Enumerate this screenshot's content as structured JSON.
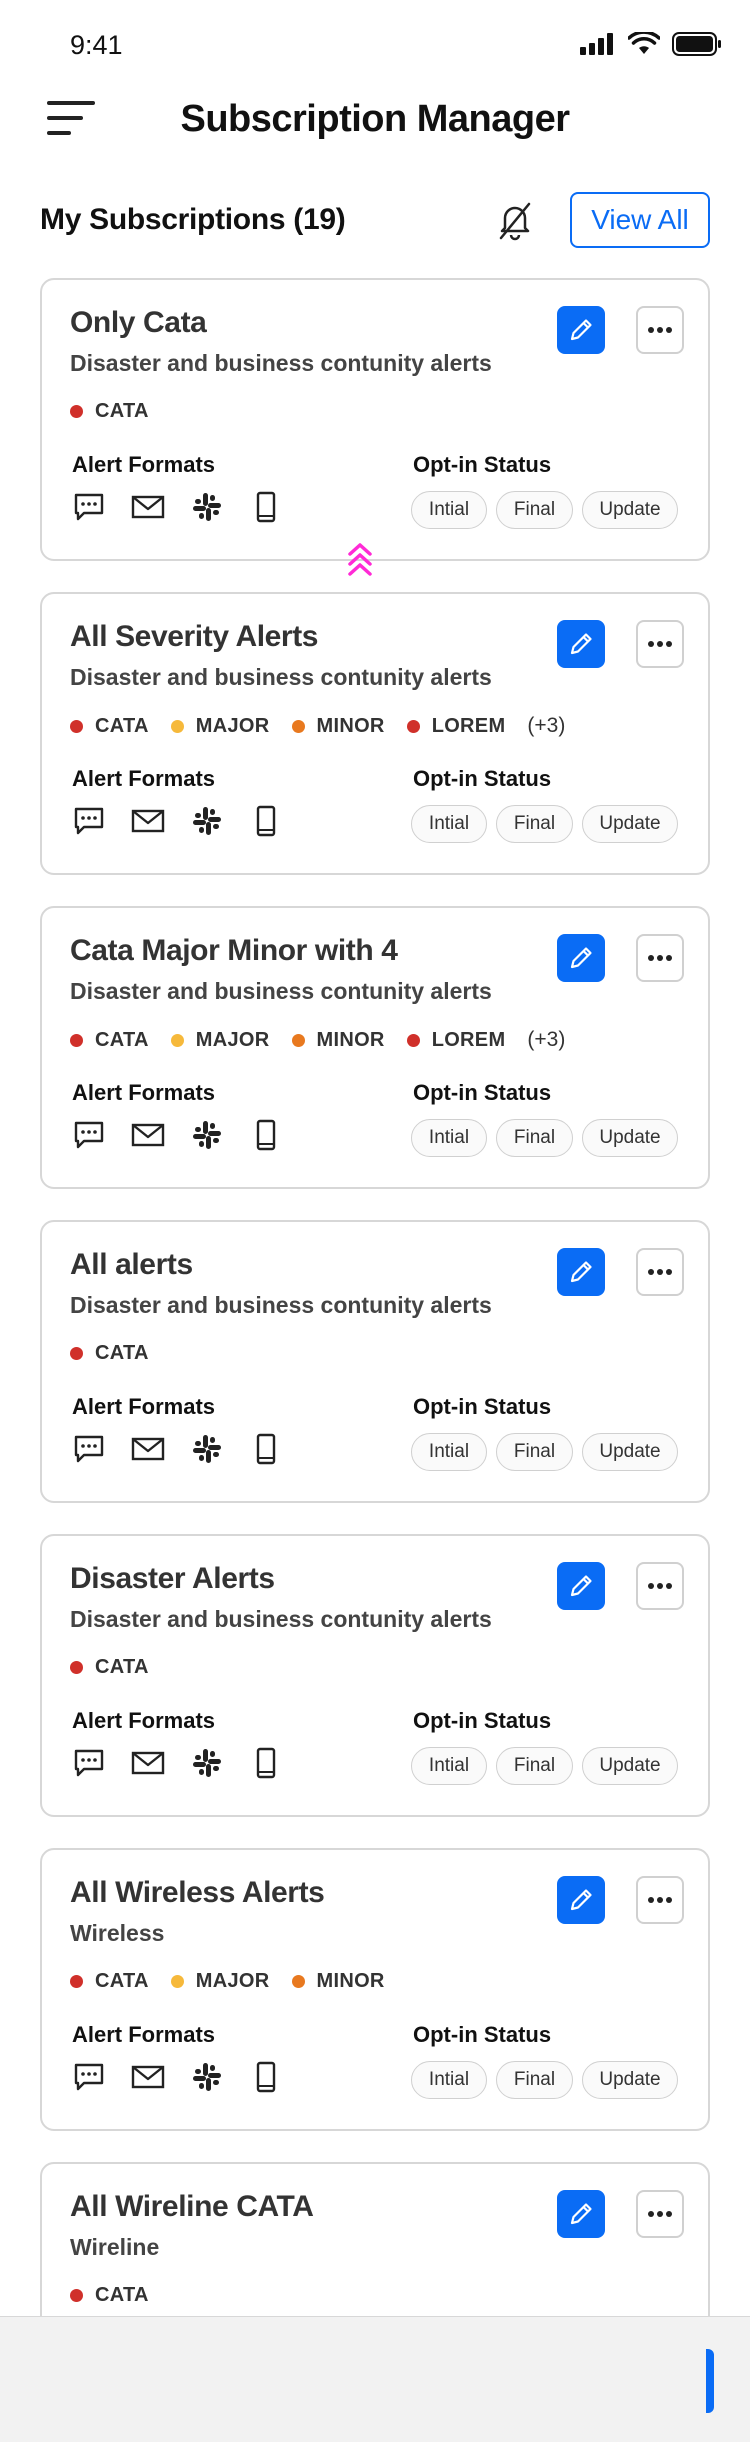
{
  "status_bar": {
    "time": "9:41"
  },
  "header": {
    "title": "Subscription Manager"
  },
  "subscriptions": {
    "heading": "My Subscriptions (19)",
    "view_all_label": "View All"
  },
  "colors": {
    "accent": "#0a6cf5",
    "cata": "#d0302a",
    "major": "#f6b93b",
    "minor": "#e8791f",
    "lorem": "#d0302a"
  },
  "card_labels": {
    "alert_formats": "Alert Formats",
    "optin_status": "Opt-in Status",
    "pills": [
      "Intial",
      "Final",
      "Update"
    ]
  },
  "cards": [
    {
      "title": "Only Cata",
      "subtitle": "Disaster and business contunity alerts",
      "tags": [
        {
          "label": "CATA",
          "color": "#d0302a"
        }
      ],
      "more": ""
    },
    {
      "title": "All Severity Alerts",
      "subtitle": "Disaster and business contunity alerts",
      "tags": [
        {
          "label": "CATA",
          "color": "#d0302a"
        },
        {
          "label": "MAJOR",
          "color": "#f6b93b"
        },
        {
          "label": "MINOR",
          "color": "#e8791f"
        },
        {
          "label": "LOREM",
          "color": "#d0302a"
        }
      ],
      "more": "(+3)"
    },
    {
      "title": "Cata Major Minor with 4",
      "subtitle": "Disaster and business contunity alerts",
      "tags": [
        {
          "label": "CATA",
          "color": "#d0302a"
        },
        {
          "label": "MAJOR",
          "color": "#f6b93b"
        },
        {
          "label": "MINOR",
          "color": "#e8791f"
        },
        {
          "label": "LOREM",
          "color": "#d0302a"
        }
      ],
      "more": "(+3)"
    },
    {
      "title": "All alerts",
      "subtitle": "Disaster and business contunity alerts",
      "tags": [
        {
          "label": "CATA",
          "color": "#d0302a"
        }
      ],
      "more": ""
    },
    {
      "title": "Disaster Alerts",
      "subtitle": "Disaster and business contunity alerts",
      "tags": [
        {
          "label": "CATA",
          "color": "#d0302a"
        }
      ],
      "more": ""
    },
    {
      "title": "All Wireless Alerts",
      "subtitle": "Wireless",
      "tags": [
        {
          "label": "CATA",
          "color": "#d0302a"
        },
        {
          "label": "MAJOR",
          "color": "#f6b93b"
        },
        {
          "label": "MINOR",
          "color": "#e8791f"
        }
      ],
      "more": ""
    },
    {
      "title": "All Wireline CATA",
      "subtitle": "Wireline",
      "tags": [
        {
          "label": "CATA",
          "color": "#d0302a"
        }
      ],
      "more": ""
    }
  ]
}
